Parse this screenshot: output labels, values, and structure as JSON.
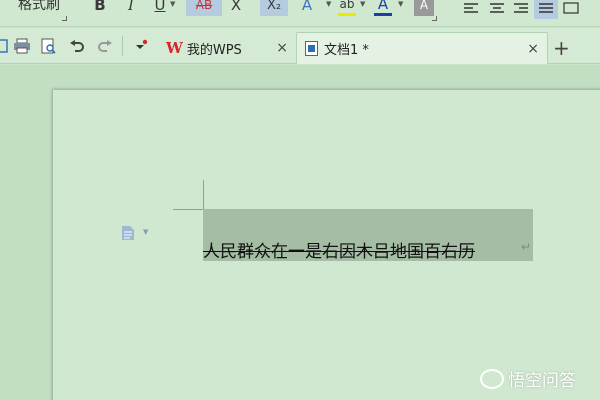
{
  "ribbon": {
    "format_painter_label": "格式刷",
    "bold": "B",
    "italic": "I",
    "underline": "U",
    "strikethrough": "AB",
    "clear_format": "X",
    "subscript": "X₂",
    "text_effect": "A",
    "highlight": "ab",
    "font_color": "A",
    "char_shading": "A"
  },
  "quick_access": {
    "save_icon": "save-icon",
    "print_icon": "print-icon",
    "print_preview_icon": "print-preview-icon",
    "undo_icon": "undo-icon",
    "redo_icon": "redo-icon",
    "customize_icon": "customize-icon"
  },
  "tabs": [
    {
      "label": "我的WPS",
      "logo": "W",
      "close": "×"
    },
    {
      "label": "文档1 *",
      "close": "×"
    }
  ],
  "add_tab": "+",
  "document": {
    "selected_text": "人民群众在一是右因木吕地国百右历",
    "paragraph_mark": "↵"
  },
  "watermark": "悟空问答",
  "colors": {
    "wps_red": "#d3272b",
    "doc_blue": "#2a6fb3",
    "eye_green": "#cfe8cf",
    "selection": "#a5bca5"
  }
}
